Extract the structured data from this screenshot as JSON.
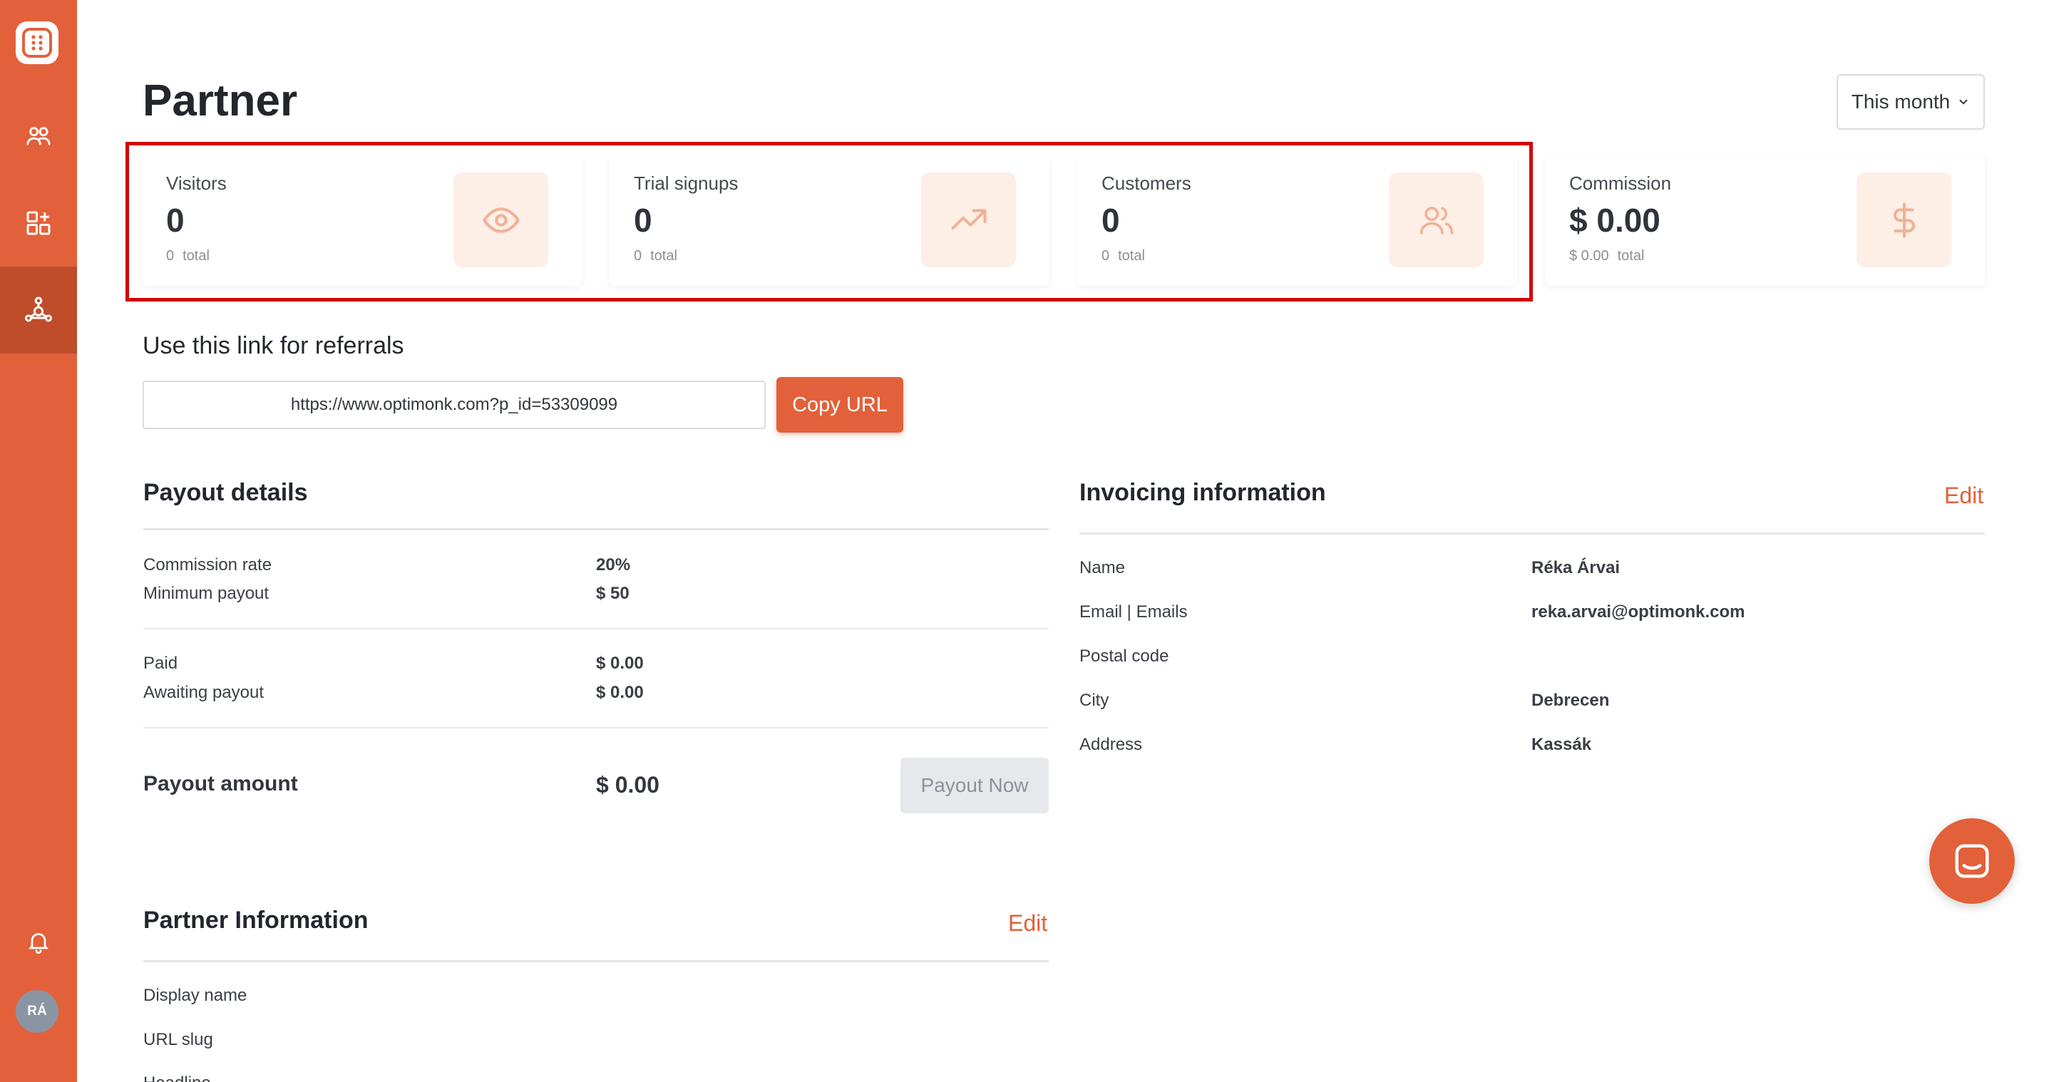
{
  "colors": {
    "accent": "#e2613a",
    "sidebar_active": "#bf4d2c",
    "highlight": "#d40000"
  },
  "sidebar": {
    "items": [
      {
        "icon": "users-icon"
      },
      {
        "icon": "grid-plus-icon"
      },
      {
        "icon": "partner-network-icon"
      }
    ],
    "avatar_initials": "RÁ"
  },
  "header": {
    "title": "Partner",
    "period": "This month"
  },
  "stats": [
    {
      "label": "Visitors",
      "value": "0",
      "total_value": "0",
      "total_label": "total",
      "icon": "eye-icon"
    },
    {
      "label": "Trial signups",
      "value": "0",
      "total_value": "0",
      "total_label": "total",
      "icon": "trending-up-icon"
    },
    {
      "label": "Customers",
      "value": "0",
      "total_value": "0",
      "total_label": "total",
      "icon": "users-icon"
    },
    {
      "label": "Commission",
      "value": "$ 0.00",
      "total_value": "$ 0.00",
      "total_label": "total",
      "icon": "dollar-icon"
    }
  ],
  "referral": {
    "title": "Use this link for referrals",
    "url": "https://www.optimonk.com?p_id=53309099",
    "copy_label": "Copy URL"
  },
  "payout": {
    "title": "Payout details",
    "rows": [
      {
        "label": "Commission rate",
        "value": "20%"
      },
      {
        "label": "Minimum payout",
        "value": "$ 50"
      },
      {
        "label": "Paid",
        "value": "$ 0.00"
      },
      {
        "label": "Awaiting payout",
        "value": "$ 0.00"
      }
    ],
    "amount_label": "Payout amount",
    "amount_value": "$ 0.00",
    "button_label": "Payout Now"
  },
  "invoicing": {
    "title": "Invoicing information",
    "edit_label": "Edit",
    "rows": [
      {
        "label": "Name",
        "value": "Réka Árvai"
      },
      {
        "label": "Email | Emails",
        "value": "reka.arvai@optimonk.com"
      },
      {
        "label": "Postal code",
        "value": ""
      },
      {
        "label": "City",
        "value": "Debrecen"
      },
      {
        "label": "Address",
        "value": "Kassák"
      }
    ]
  },
  "partner_info": {
    "title": "Partner Information",
    "edit_label": "Edit",
    "rows": [
      {
        "label": "Display name"
      },
      {
        "label": "URL slug"
      },
      {
        "label": "Headline"
      }
    ]
  }
}
